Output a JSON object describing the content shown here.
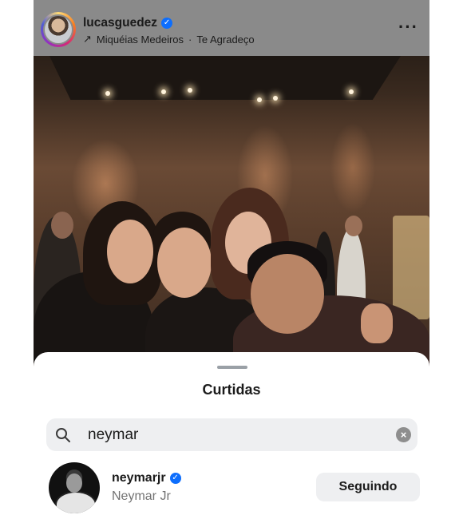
{
  "post": {
    "username": "lucasguedez",
    "verified": true,
    "music_artist": "Miquéias Medeiros",
    "separator": "·",
    "music_title": "Te Agradeço"
  },
  "likes_sheet": {
    "title": "Curtidas",
    "search": {
      "value": "neymar",
      "clear_icon": "clear-icon"
    },
    "results": [
      {
        "username": "neymarjr",
        "verified": true,
        "full_name": "Neymar Jr",
        "button_label": "Seguindo"
      }
    ]
  },
  "colors": {
    "verified_blue": "#0d6efd",
    "header_overlay": "#8a8a8a",
    "button_bg": "#eeeff1"
  }
}
